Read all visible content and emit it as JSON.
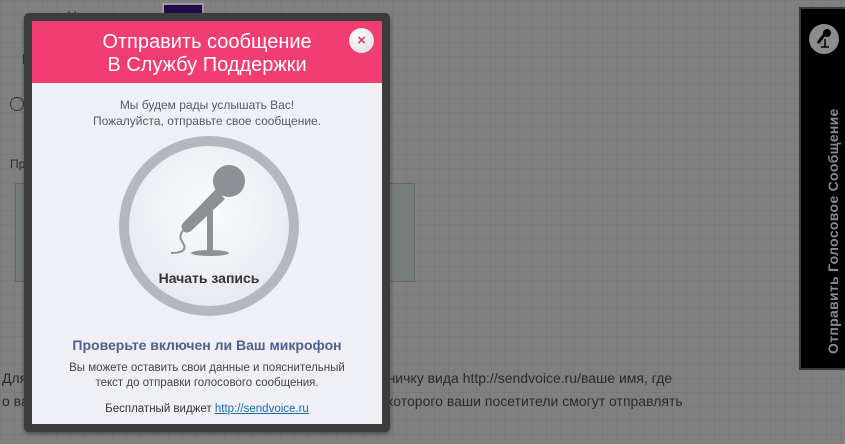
{
  "background_page": {
    "button_color_label": "Цвет кнопки:",
    "color_label_fragment": "Ц",
    "example_label_fragment": "При",
    "textarea_fragment_1": "<",
    "textarea_fragment_2": "П",
    "paragraph_line1_start": "Для",
    "paragraph_line1_end": "раничку вида http://sendvoice.ru/ваше имя, где",
    "paragraph_line2_start": "о ва",
    "paragraph_line2_end": "которого ваши посетители смогут отправлять"
  },
  "modal": {
    "title_line1": "Отправить сообщение",
    "title_line2": "В Службу Поддержки",
    "close_icon": "×",
    "intro_line1": "Мы будем рады услышать Вас!",
    "intro_line2": "Пожалуйста, отправьте свое сообщение.",
    "record_label": "Начать запись",
    "check_mic": "Проверьте включен ли Ваш микрофон",
    "note_line1": "Вы можете оставить свои данные и пояснительный",
    "note_line2": "текст до отправки голосового сообщения.",
    "free_widget_label": "Бесплатный виджет",
    "free_widget_link": "http://sendvoice.ru"
  },
  "side_button": {
    "label": "Отправить Голосовое Сообщение"
  },
  "colors": {
    "header": "#f23d72",
    "swatch": "#1e0b4a",
    "link": "#1a6bb3"
  }
}
